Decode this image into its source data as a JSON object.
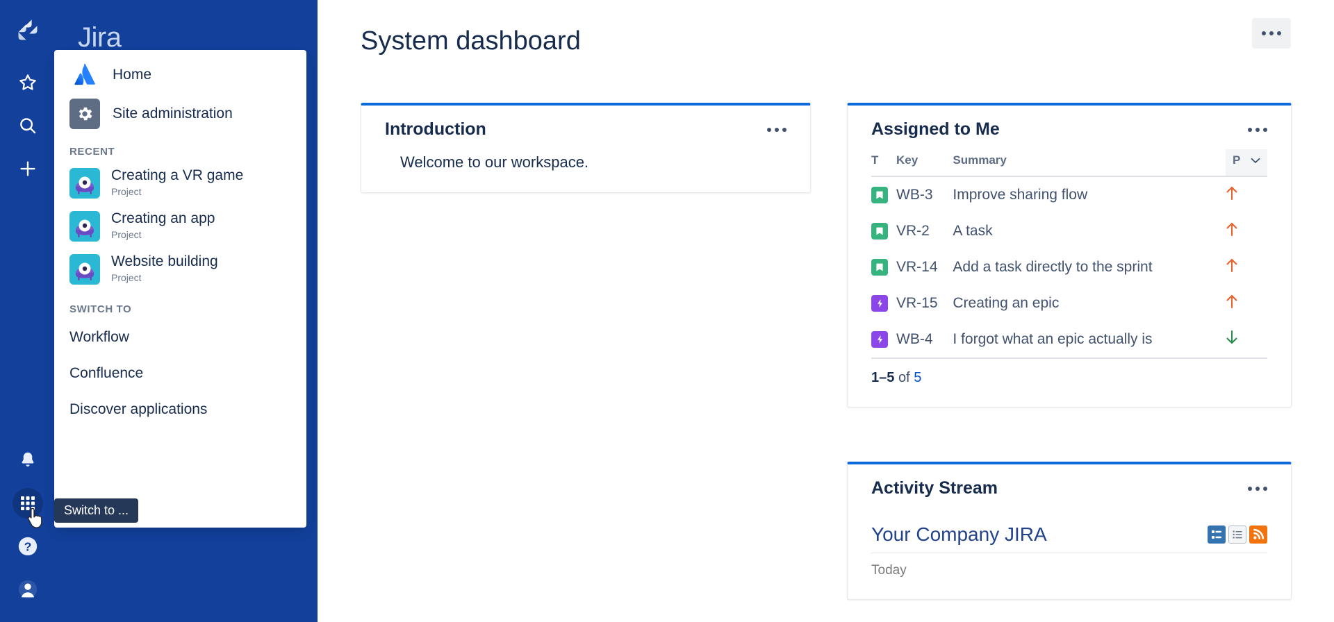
{
  "brand": {
    "name": "Jira",
    "accent": "#0b6bdb",
    "sidebar_bg": "#12409a"
  },
  "rail": {
    "top_items": [
      {
        "name": "jira-logo-icon",
        "label": "Jira"
      },
      {
        "name": "starred-icon",
        "label": "Starred"
      },
      {
        "name": "search-icon",
        "label": "Search"
      },
      {
        "name": "create-icon",
        "label": "Create"
      }
    ],
    "bottom_items": [
      {
        "name": "notifications-icon",
        "label": "Notifications"
      },
      {
        "name": "app-switcher-icon",
        "label": "Switch to ...",
        "active": true
      },
      {
        "name": "help-icon",
        "label": "Help"
      },
      {
        "name": "profile-avatar-icon",
        "label": "Your profile"
      }
    ]
  },
  "tooltip": {
    "text": "Switch to ..."
  },
  "menu": {
    "home_label": "Home",
    "site_admin_label": "Site administration",
    "recent_heading": "RECENT",
    "recent": [
      {
        "name": "Creating a VR game",
        "type": "Project"
      },
      {
        "name": "Creating an app",
        "type": "Project"
      },
      {
        "name": "Website building",
        "type": "Project"
      }
    ],
    "switch_heading": "SWITCH TO",
    "switch_items": [
      {
        "label": "Workflow"
      },
      {
        "label": "Confluence"
      },
      {
        "label": "Discover applications"
      }
    ]
  },
  "header": {
    "title": "System dashboard",
    "more_label": "More actions"
  },
  "gadgets": {
    "introduction": {
      "title": "Introduction",
      "body": "Welcome to our workspace."
    },
    "assigned_to_me": {
      "title": "Assigned to Me",
      "columns": {
        "type": "T",
        "key": "Key",
        "summary": "Summary",
        "priority": "P"
      },
      "rows": [
        {
          "type": "story",
          "key": "WB-3",
          "summary": "Improve sharing flow",
          "priority": "high"
        },
        {
          "type": "story",
          "key": "VR-2",
          "summary": "A task",
          "priority": "high"
        },
        {
          "type": "story",
          "key": "VR-14",
          "summary": "Add a task directly to the sprint",
          "priority": "high"
        },
        {
          "type": "epic",
          "key": "VR-15",
          "summary": "Creating an epic",
          "priority": "high"
        },
        {
          "type": "epic",
          "key": "WB-4",
          "summary": "I forgot what an epic actually is",
          "priority": "low"
        }
      ],
      "pager": {
        "range": "1–5",
        "of": "of",
        "total": "5"
      }
    },
    "activity_stream": {
      "title": "Activity Stream",
      "source": "Your Company JIRA",
      "today": "Today",
      "icons": [
        "summary-view-icon",
        "list-view-icon",
        "rss-feed-icon"
      ]
    }
  }
}
